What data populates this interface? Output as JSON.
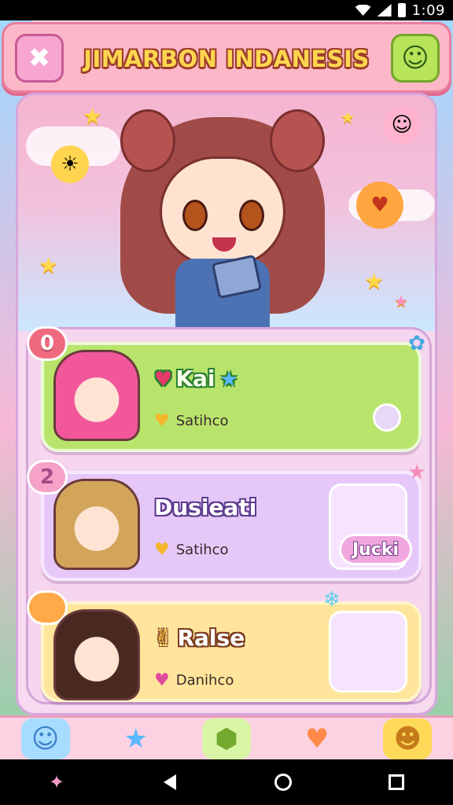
{
  "status_bar": {
    "time": "1:09"
  },
  "header": {
    "title": "JIMARBON INDANESIS",
    "back_icon": "✖",
    "mascot_icon": "☺"
  },
  "hero": {
    "stars": [
      "★",
      "★",
      "★",
      "★",
      "★"
    ],
    "critters": [
      "☀",
      "☺",
      "♥"
    ]
  },
  "players": [
    {
      "rank": "0",
      "name": "Kai",
      "subtitle": "Satihco",
      "bg": "#b8e46c",
      "sub_heart": "♥",
      "sub_heart_color": "#f5b62b"
    },
    {
      "rank": "2",
      "name": "Dusieati",
      "subtitle": "Satihco",
      "bg": "#e6c8f8",
      "sub_heart": "♥",
      "sub_heart_color": "#f5b62b",
      "friend_tag": "Jucki"
    },
    {
      "rank": "",
      "name": "Ralse",
      "subtitle": "Danihco",
      "bg": "#ffe59b",
      "sub_heart": "♥",
      "sub_heart_color": "#e04a9c"
    }
  ],
  "nav": {
    "items": [
      {
        "icon": "☺",
        "name": "bear-icon"
      },
      {
        "icon": "★",
        "name": "star-icon"
      },
      {
        "icon": "⬢",
        "name": "home-icon"
      },
      {
        "icon": "♥",
        "name": "tag-icon"
      },
      {
        "icon": "☻",
        "name": "bear-friend-icon"
      }
    ]
  }
}
